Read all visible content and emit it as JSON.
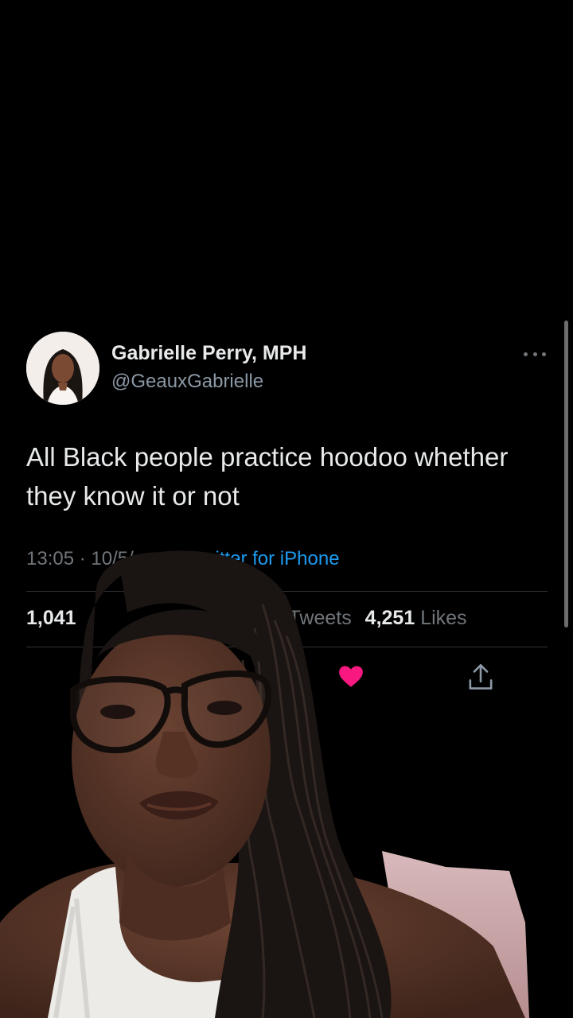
{
  "tweet": {
    "display_name": "Gabrielle Perry, MPH",
    "handle": "@GeauxGabrielle",
    "text": "All Black people practice hoodoo whether they know it or not",
    "time": "13:05",
    "separator": " · ",
    "date_visible": "10/5/",
    "source_visible": "itter for iPhone",
    "retweets_visible": "1,041",
    "retweets_label_visible": "Tweets",
    "likes_count": "4,251",
    "likes_label": "Likes"
  },
  "icons": {
    "more": "more-horizontal-icon",
    "like": "heart-filled-icon",
    "share": "share-upload-icon"
  },
  "colors": {
    "background": "#000000",
    "text_primary": "#e7e9ea",
    "text_secondary": "#8b98a5",
    "link": "#1d9bf0",
    "like": "#f91880",
    "divider": "#2f3336"
  }
}
